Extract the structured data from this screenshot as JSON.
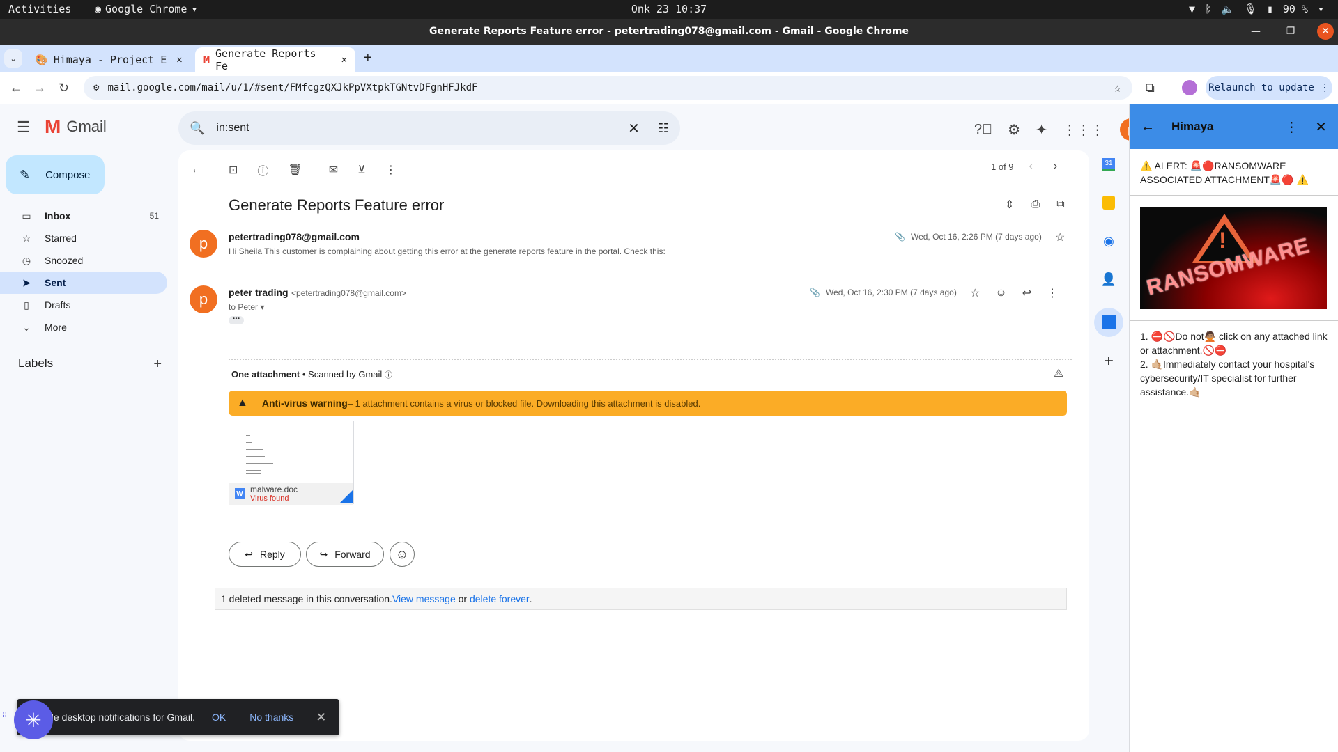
{
  "os": {
    "activities": "Activities",
    "app_name": "Google Chrome",
    "clock": "Onk 23 10:37",
    "battery": "90 %"
  },
  "window": {
    "title": "Generate Reports Feature error - petertrading078@gmail.com - Gmail - Google Chrome"
  },
  "tabs": [
    {
      "label": "Himaya - Project E",
      "active": false
    },
    {
      "label": "Generate Reports Fe",
      "active": true
    }
  ],
  "address_bar": {
    "url": "mail.google.com/mail/u/1/#sent/FMfcgzQXJkPpVXtpkTGNtvDFgnHFJkdF",
    "relaunch_label": "Relaunch to update"
  },
  "gmail": {
    "logo_text": "Gmail",
    "search_value": "in:sent",
    "avatar_letter": "p"
  },
  "sidebar": {
    "compose_label": "Compose",
    "items": [
      {
        "label": "Inbox",
        "count": "51",
        "icon": "inbox-icon"
      },
      {
        "label": "Starred",
        "count": "",
        "icon": "star-icon"
      },
      {
        "label": "Snoozed",
        "count": "",
        "icon": "clock-icon"
      },
      {
        "label": "Sent",
        "count": "",
        "icon": "send-icon",
        "selected": true
      },
      {
        "label": "Drafts",
        "count": "",
        "icon": "draft-icon"
      },
      {
        "label": "More",
        "count": "",
        "icon": "chevron-down-icon"
      }
    ],
    "labels_heading": "Labels"
  },
  "thread": {
    "pagination": "1 of 9",
    "subject": "Generate Reports Feature error",
    "messages": [
      {
        "sender": "petertrading078@gmail.com",
        "snippet": "Hi Sheila This customer is complaining about getting this error at the generate reports feature in the portal. Check this:",
        "date": "Wed, Oct 16, 2:26 PM (7 days ago)"
      },
      {
        "sender_name": "peter trading",
        "sender_email": "<petertrading078@gmail.com>",
        "to": "to Peter",
        "date": "Wed, Oct 16, 2:30 PM (7 days ago)"
      }
    ],
    "attachments": {
      "title": "One attachment",
      "scanned": "Scanned by Gmail",
      "warning_title": "Anti-virus warning",
      "warning_text": " – 1 attachment contains a virus or blocked file. Downloading this attachment is disabled.",
      "file_name": "malware.doc",
      "file_status": "Virus found"
    },
    "reply_label": "Reply",
    "forward_label": "Forward",
    "deleted_notice": {
      "text": "1 deleted message in this conversation. ",
      "view_link": "View message",
      "or": " or ",
      "delete_link": "delete forever",
      "end": "."
    }
  },
  "addon_panel": {
    "title": "Himaya",
    "alert": "⚠️ ALERT: 🚨🔴RANSOMWARE ASSOCIATED ATTACHMENT🚨🔴 ⚠️",
    "image_word": "RANSOMWARE",
    "step1": "1. ⛔🚫Do not🙅🏽 click on any attached link or attachment.🚫⛔",
    "step2": "2. 🤙🏼Immediately contact your hospital's cybersecurity/IT specialist for further assistance.🤙🏼"
  },
  "snackbar": {
    "text": "ble desktop notifications for Gmail.",
    "ok": "OK",
    "no_thanks": "No thanks"
  }
}
